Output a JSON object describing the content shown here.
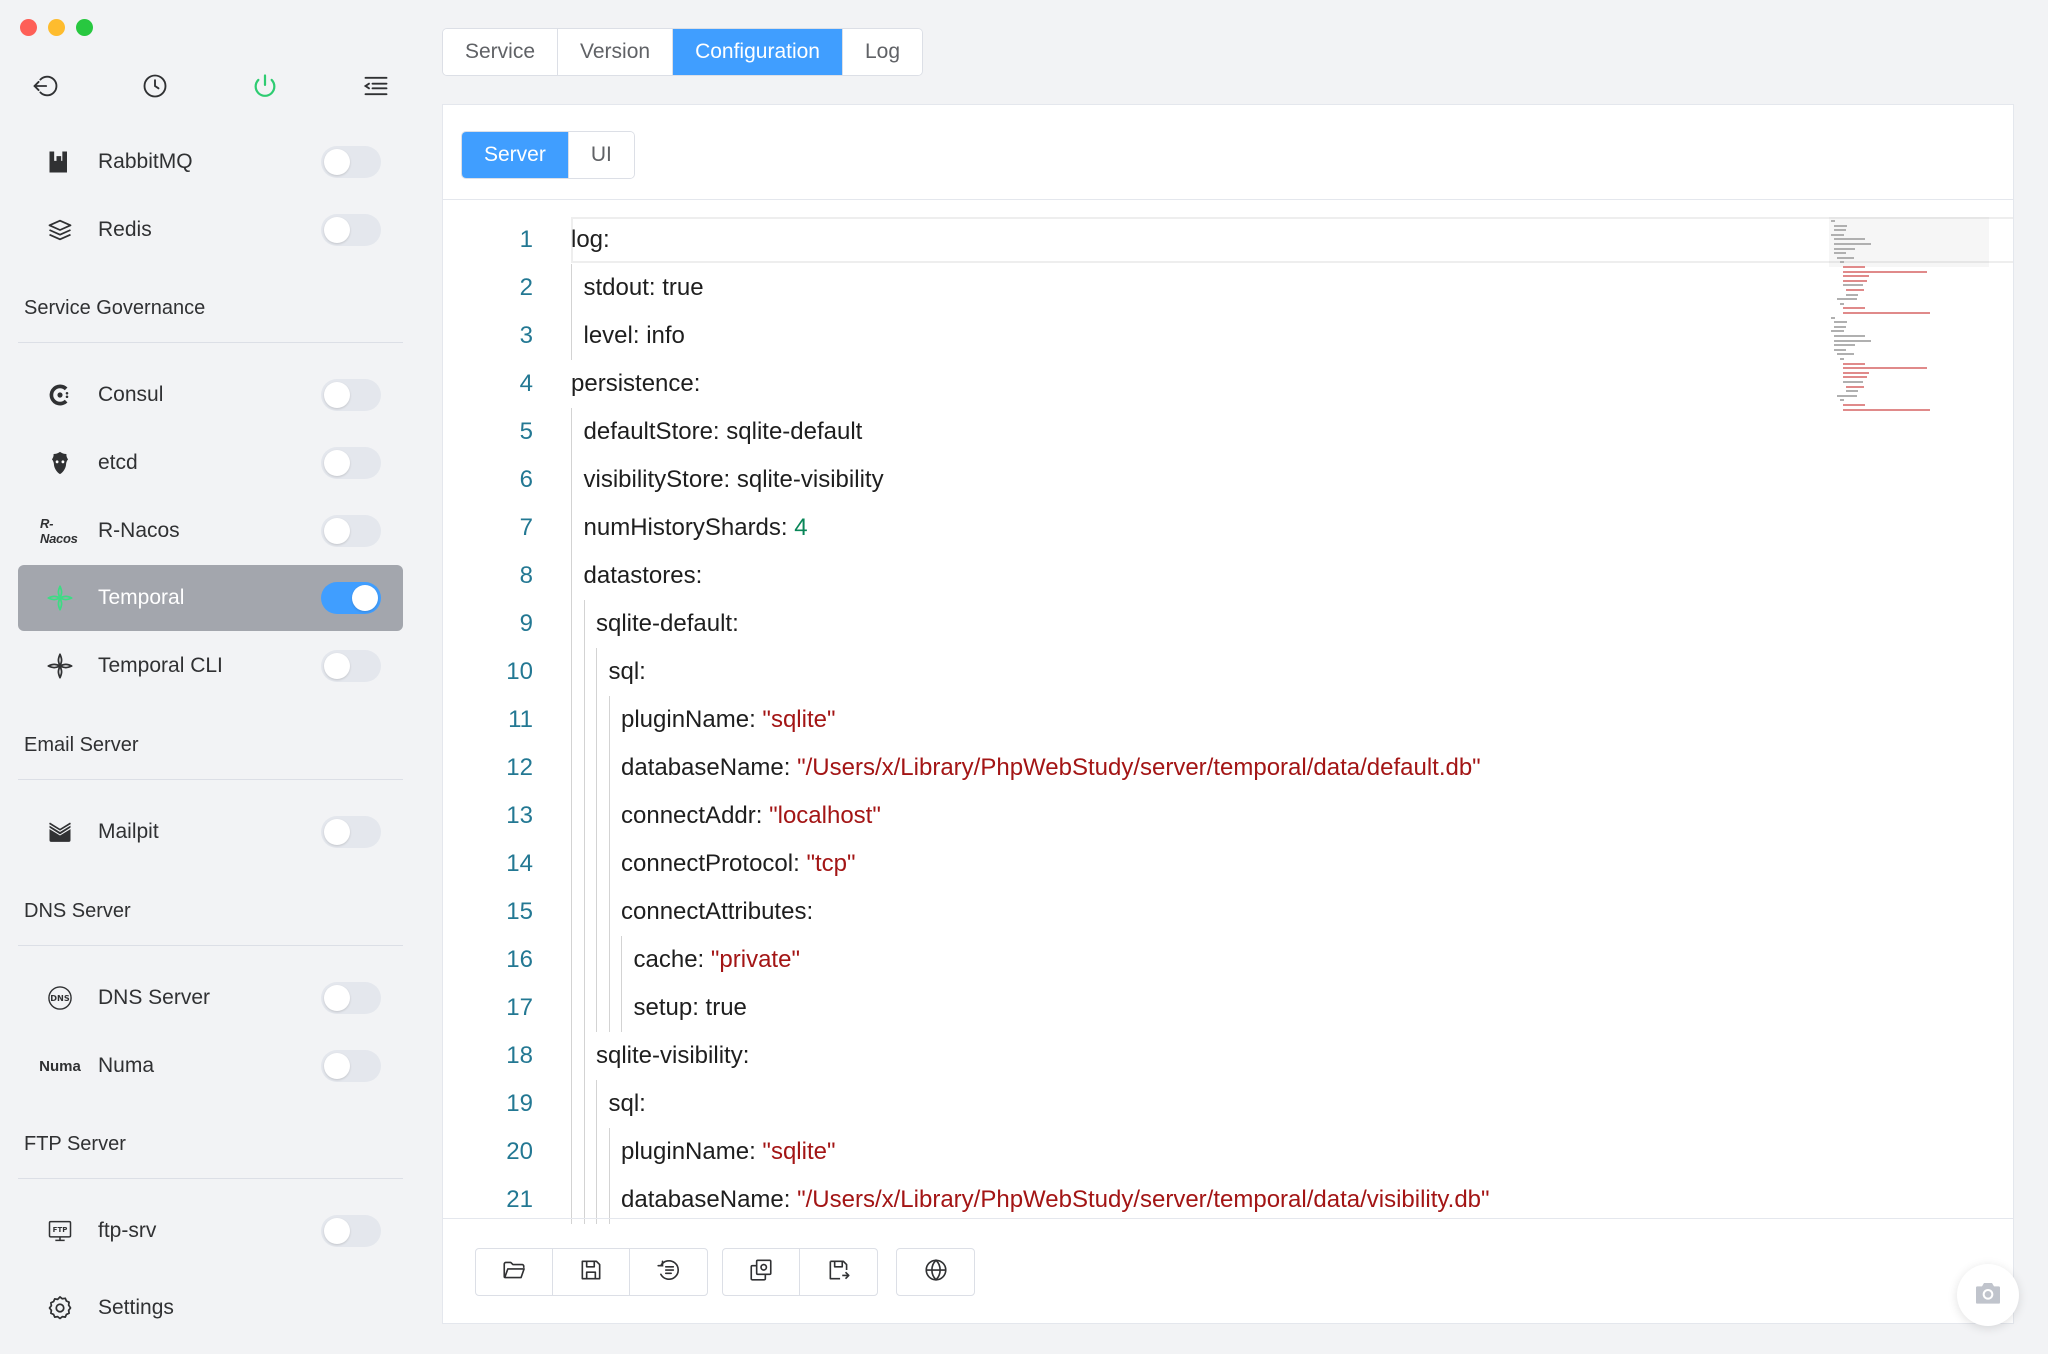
{
  "top_icons": [
    {
      "icon": "back-icon"
    },
    {
      "icon": "clock-icon"
    },
    {
      "icon": "power-icon",
      "color": "#2ecc71"
    },
    {
      "icon": "menu-indent-icon"
    }
  ],
  "sidebar": {
    "items_top": [
      {
        "label": "RabbitMQ",
        "icon": "rabbitmq-icon",
        "on": false
      },
      {
        "label": "Redis",
        "icon": "redis-icon",
        "on": false
      }
    ],
    "sections": [
      {
        "title": "Service Governance",
        "items": [
          {
            "label": "Consul",
            "icon": "consul-icon",
            "on": false
          },
          {
            "label": "etcd",
            "icon": "etcd-icon",
            "on": false
          },
          {
            "label": "R-Nacos",
            "icon": "r-nacos-icon",
            "logo_text": "R-Nacos",
            "on": false
          },
          {
            "label": "Temporal",
            "icon": "temporal-icon",
            "on": true,
            "active": true
          },
          {
            "label": "Temporal CLI",
            "icon": "temporal-cli-icon",
            "on": false
          }
        ]
      },
      {
        "title": "Email Server",
        "items": [
          {
            "label": "Mailpit",
            "icon": "mailpit-icon",
            "on": false
          }
        ]
      },
      {
        "title": "DNS Server",
        "items": [
          {
            "label": "DNS Server",
            "icon": "dns-icon",
            "on": false
          },
          {
            "label": "Numa",
            "icon": "numa-icon",
            "logo_text": "Numa",
            "on": false
          }
        ]
      },
      {
        "title": "FTP Server",
        "items": [
          {
            "label": "ftp-srv",
            "icon": "ftp-icon",
            "on": false
          }
        ]
      }
    ],
    "settings_label": "Settings"
  },
  "tabs": {
    "service": "Service",
    "version": "Version",
    "configuration": "Configuration",
    "log": "Log",
    "active": "Configuration"
  },
  "subtabs": {
    "server": "Server",
    "ui": "UI",
    "active": "Server"
  },
  "editor": {
    "lines": [
      {
        "n": "1",
        "indent": 0,
        "parts": [
          {
            "t": "log:"
          }
        ]
      },
      {
        "n": "2",
        "indent": 1,
        "parts": [
          {
            "t": "stdout: true"
          }
        ]
      },
      {
        "n": "3",
        "indent": 1,
        "parts": [
          {
            "t": "level: info"
          }
        ]
      },
      {
        "n": "4",
        "indent": 0,
        "parts": [
          {
            "t": "persistence:"
          }
        ]
      },
      {
        "n": "5",
        "indent": 1,
        "parts": [
          {
            "t": "defaultStore: sqlite-default"
          }
        ]
      },
      {
        "n": "6",
        "indent": 1,
        "parts": [
          {
            "t": "visibilityStore: sqlite-visibility"
          }
        ]
      },
      {
        "n": "7",
        "indent": 1,
        "parts": [
          {
            "t": "numHistoryShards: "
          },
          {
            "t": "4",
            "c": "num"
          }
        ]
      },
      {
        "n": "8",
        "indent": 1,
        "parts": [
          {
            "t": "datastores:"
          }
        ]
      },
      {
        "n": "9",
        "indent": 2,
        "parts": [
          {
            "t": "sqlite-default:"
          }
        ]
      },
      {
        "n": "10",
        "indent": 3,
        "parts": [
          {
            "t": "sql:"
          }
        ]
      },
      {
        "n": "11",
        "indent": 4,
        "parts": [
          {
            "t": "pluginName: "
          },
          {
            "t": "\"sqlite\"",
            "c": "str"
          }
        ]
      },
      {
        "n": "12",
        "indent": 4,
        "parts": [
          {
            "t": "databaseName: "
          },
          {
            "t": "\"/Users/x/Library/PhpWebStudy/server/temporal/data/default.db\"",
            "c": "str"
          }
        ]
      },
      {
        "n": "13",
        "indent": 4,
        "parts": [
          {
            "t": "connectAddr: "
          },
          {
            "t": "\"localhost\"",
            "c": "str"
          }
        ]
      },
      {
        "n": "14",
        "indent": 4,
        "parts": [
          {
            "t": "connectProtocol: "
          },
          {
            "t": "\"tcp\"",
            "c": "str"
          }
        ]
      },
      {
        "n": "15",
        "indent": 4,
        "parts": [
          {
            "t": "connectAttributes:"
          }
        ]
      },
      {
        "n": "16",
        "indent": 5,
        "parts": [
          {
            "t": "cache: "
          },
          {
            "t": "\"private\"",
            "c": "str"
          }
        ]
      },
      {
        "n": "17",
        "indent": 5,
        "parts": [
          {
            "t": "setup: true"
          }
        ]
      },
      {
        "n": "18",
        "indent": 2,
        "parts": [
          {
            "t": "sqlite-visibility:"
          }
        ]
      },
      {
        "n": "19",
        "indent": 3,
        "parts": [
          {
            "t": "sql:"
          }
        ]
      },
      {
        "n": "20",
        "indent": 4,
        "parts": [
          {
            "t": "pluginName: "
          },
          {
            "t": "\"sqlite\"",
            "c": "str"
          }
        ]
      },
      {
        "n": "21",
        "indent": 4,
        "parts": [
          {
            "t": "databaseName: "
          },
          {
            "t": "\"/Users/x/Library/PhpWebStudy/server/temporal/data/visibility.db\"",
            "c": "str"
          }
        ]
      }
    ]
  },
  "toolbar": {
    "group1": [
      {
        "icon": "folder-open-icon"
      },
      {
        "icon": "save-icon"
      },
      {
        "icon": "log-list-icon"
      }
    ],
    "group2": [
      {
        "icon": "copy-config-icon"
      },
      {
        "icon": "export-config-icon"
      }
    ],
    "group3": [
      {
        "icon": "globe-icon"
      }
    ],
    "camera": {
      "icon": "camera-icon"
    }
  },
  "colors": {
    "accent": "#409eff",
    "power_green": "#2ecc71",
    "string": "#a31515",
    "number": "#098658",
    "line_number": "#237893"
  }
}
